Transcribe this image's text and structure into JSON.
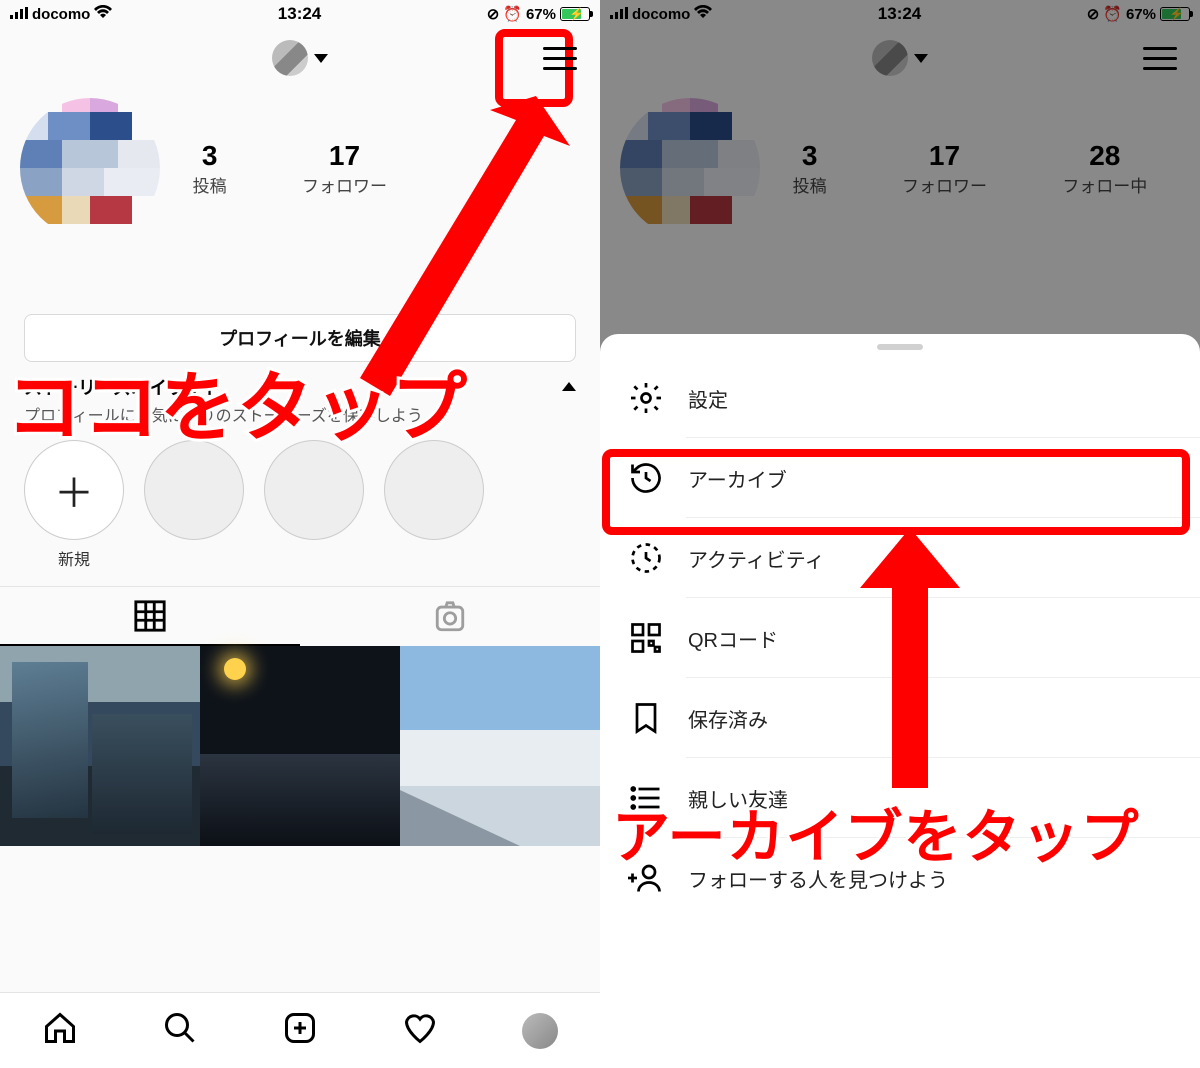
{
  "status": {
    "carrier": "docomo",
    "time": "13:24",
    "battery_pct": "67%"
  },
  "profile": {
    "stats": {
      "posts": {
        "value": "3",
        "label": "投稿"
      },
      "followers": {
        "value": "17",
        "label": "フォロワー"
      },
      "following": {
        "value": "28",
        "label": "フォロー中"
      }
    },
    "edit_button": "プロフィールを編集",
    "highlights_title": "ストーリーズハイライト",
    "highlights_sub": "プロフィールにお気に入りのストーリーズを保存しよう",
    "highlight_new": "新規"
  },
  "menu": {
    "settings": "設定",
    "archive": "アーカイブ",
    "activity": "アクティビティ",
    "qr": "QRコード",
    "saved": "保存済み",
    "close_friends": "親しい友達",
    "discover": "フォローする人を見つけよう"
  },
  "annotations": {
    "tap_here": "ココをタップ",
    "tap_archive": "アーカイブをタップ"
  }
}
